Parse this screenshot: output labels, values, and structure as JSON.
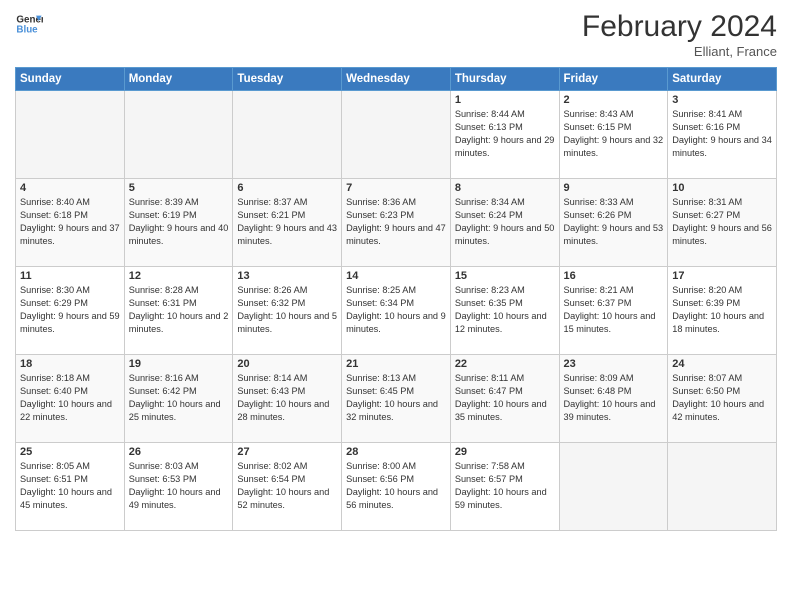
{
  "header": {
    "logo_line1": "General",
    "logo_line2": "Blue",
    "month_year": "February 2024",
    "location": "Elliant, France"
  },
  "days_of_week": [
    "Sunday",
    "Monday",
    "Tuesday",
    "Wednesday",
    "Thursday",
    "Friday",
    "Saturday"
  ],
  "weeks": [
    [
      {
        "day": "",
        "text": ""
      },
      {
        "day": "",
        "text": ""
      },
      {
        "day": "",
        "text": ""
      },
      {
        "day": "",
        "text": ""
      },
      {
        "day": "1",
        "text": "Sunrise: 8:44 AM\nSunset: 6:13 PM\nDaylight: 9 hours and 29 minutes."
      },
      {
        "day": "2",
        "text": "Sunrise: 8:43 AM\nSunset: 6:15 PM\nDaylight: 9 hours and 32 minutes."
      },
      {
        "day": "3",
        "text": "Sunrise: 8:41 AM\nSunset: 6:16 PM\nDaylight: 9 hours and 34 minutes."
      }
    ],
    [
      {
        "day": "4",
        "text": "Sunrise: 8:40 AM\nSunset: 6:18 PM\nDaylight: 9 hours and 37 minutes."
      },
      {
        "day": "5",
        "text": "Sunrise: 8:39 AM\nSunset: 6:19 PM\nDaylight: 9 hours and 40 minutes."
      },
      {
        "day": "6",
        "text": "Sunrise: 8:37 AM\nSunset: 6:21 PM\nDaylight: 9 hours and 43 minutes."
      },
      {
        "day": "7",
        "text": "Sunrise: 8:36 AM\nSunset: 6:23 PM\nDaylight: 9 hours and 47 minutes."
      },
      {
        "day": "8",
        "text": "Sunrise: 8:34 AM\nSunset: 6:24 PM\nDaylight: 9 hours and 50 minutes."
      },
      {
        "day": "9",
        "text": "Sunrise: 8:33 AM\nSunset: 6:26 PM\nDaylight: 9 hours and 53 minutes."
      },
      {
        "day": "10",
        "text": "Sunrise: 8:31 AM\nSunset: 6:27 PM\nDaylight: 9 hours and 56 minutes."
      }
    ],
    [
      {
        "day": "11",
        "text": "Sunrise: 8:30 AM\nSunset: 6:29 PM\nDaylight: 9 hours and 59 minutes."
      },
      {
        "day": "12",
        "text": "Sunrise: 8:28 AM\nSunset: 6:31 PM\nDaylight: 10 hours and 2 minutes."
      },
      {
        "day": "13",
        "text": "Sunrise: 8:26 AM\nSunset: 6:32 PM\nDaylight: 10 hours and 5 minutes."
      },
      {
        "day": "14",
        "text": "Sunrise: 8:25 AM\nSunset: 6:34 PM\nDaylight: 10 hours and 9 minutes."
      },
      {
        "day": "15",
        "text": "Sunrise: 8:23 AM\nSunset: 6:35 PM\nDaylight: 10 hours and 12 minutes."
      },
      {
        "day": "16",
        "text": "Sunrise: 8:21 AM\nSunset: 6:37 PM\nDaylight: 10 hours and 15 minutes."
      },
      {
        "day": "17",
        "text": "Sunrise: 8:20 AM\nSunset: 6:39 PM\nDaylight: 10 hours and 18 minutes."
      }
    ],
    [
      {
        "day": "18",
        "text": "Sunrise: 8:18 AM\nSunset: 6:40 PM\nDaylight: 10 hours and 22 minutes."
      },
      {
        "day": "19",
        "text": "Sunrise: 8:16 AM\nSunset: 6:42 PM\nDaylight: 10 hours and 25 minutes."
      },
      {
        "day": "20",
        "text": "Sunrise: 8:14 AM\nSunset: 6:43 PM\nDaylight: 10 hours and 28 minutes."
      },
      {
        "day": "21",
        "text": "Sunrise: 8:13 AM\nSunset: 6:45 PM\nDaylight: 10 hours and 32 minutes."
      },
      {
        "day": "22",
        "text": "Sunrise: 8:11 AM\nSunset: 6:47 PM\nDaylight: 10 hours and 35 minutes."
      },
      {
        "day": "23",
        "text": "Sunrise: 8:09 AM\nSunset: 6:48 PM\nDaylight: 10 hours and 39 minutes."
      },
      {
        "day": "24",
        "text": "Sunrise: 8:07 AM\nSunset: 6:50 PM\nDaylight: 10 hours and 42 minutes."
      }
    ],
    [
      {
        "day": "25",
        "text": "Sunrise: 8:05 AM\nSunset: 6:51 PM\nDaylight: 10 hours and 45 minutes."
      },
      {
        "day": "26",
        "text": "Sunrise: 8:03 AM\nSunset: 6:53 PM\nDaylight: 10 hours and 49 minutes."
      },
      {
        "day": "27",
        "text": "Sunrise: 8:02 AM\nSunset: 6:54 PM\nDaylight: 10 hours and 52 minutes."
      },
      {
        "day": "28",
        "text": "Sunrise: 8:00 AM\nSunset: 6:56 PM\nDaylight: 10 hours and 56 minutes."
      },
      {
        "day": "29",
        "text": "Sunrise: 7:58 AM\nSunset: 6:57 PM\nDaylight: 10 hours and 59 minutes."
      },
      {
        "day": "",
        "text": ""
      },
      {
        "day": "",
        "text": ""
      }
    ]
  ]
}
